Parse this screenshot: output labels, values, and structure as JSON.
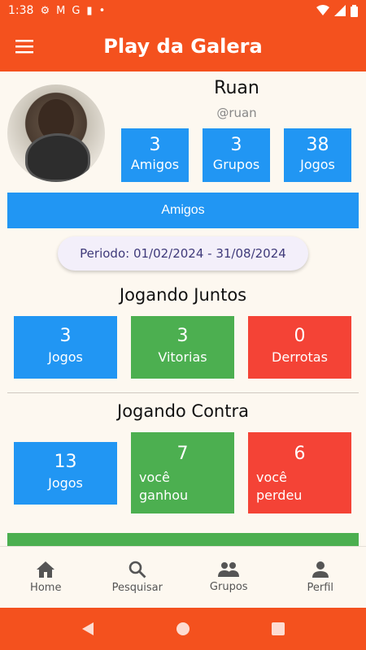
{
  "status_bar": {
    "time": "1:38"
  },
  "app_bar": {
    "title": "Play da Galera",
    "menu_icon": "menu-icon"
  },
  "profile": {
    "name": "Ruan",
    "handle": "@ruan",
    "stats": [
      {
        "value": "3",
        "label": "Amigos"
      },
      {
        "value": "3",
        "label": "Grupos"
      },
      {
        "value": "38",
        "label": "Jogos"
      }
    ]
  },
  "friends_button": "Amigos",
  "period": "Periodo: 01/02/2024 - 31/08/2024",
  "together": {
    "title": "Jogando Juntos",
    "cards": [
      {
        "value": "3",
        "label": "Jogos"
      },
      {
        "value": "3",
        "label": "Vitorias"
      },
      {
        "value": "0",
        "label": "Derrotas"
      }
    ]
  },
  "against": {
    "title": "Jogando Contra",
    "cards": [
      {
        "value": "13",
        "label": "Jogos"
      },
      {
        "value": "7",
        "label": "você\nganhou"
      },
      {
        "value": "6",
        "label": "você\nperdeu"
      }
    ]
  },
  "bottom_nav": [
    {
      "label": "Home",
      "icon": "home-icon"
    },
    {
      "label": "Pesquisar",
      "icon": "search-icon"
    },
    {
      "label": "Grupos",
      "icon": "group-icon"
    },
    {
      "label": "Perfil",
      "icon": "person-icon"
    }
  ],
  "colors": {
    "primary": "#f4511e",
    "blue": "#2196f3",
    "green": "#4caf50",
    "red": "#f44336",
    "background": "#fdf8f0"
  }
}
